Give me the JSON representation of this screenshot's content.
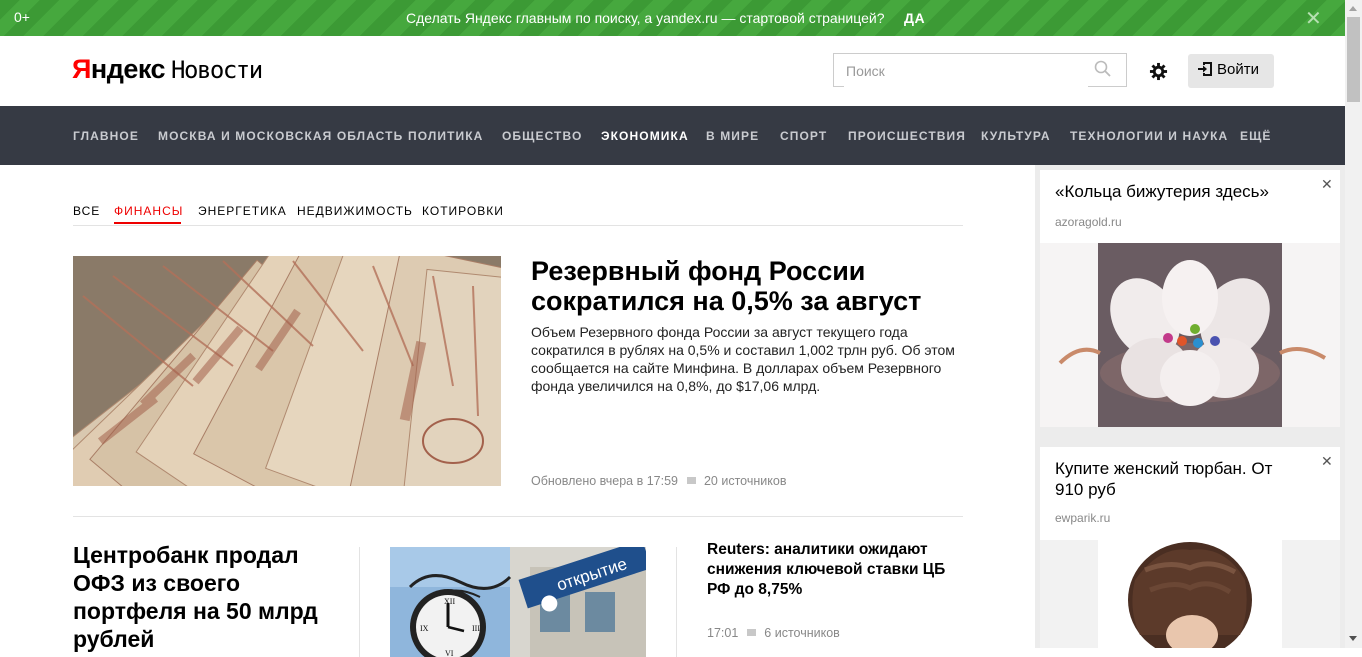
{
  "promo": {
    "age_rating": "0+",
    "message": "Сделать Яндекс главным по поиску, а yandex.ru — стартовой страницей?",
    "accept_label": "ДА",
    "close_glyph": "✕"
  },
  "header": {
    "logo_y": "Я",
    "logo_rest": "ндекс",
    "logo_service": "Новости",
    "search_placeholder": "Поиск",
    "login_label": "Войти"
  },
  "nav": {
    "items": [
      "ГЛАВНОЕ",
      "МОСКВА И МОСКОВСКАЯ ОБЛАСТЬ",
      "ПОЛИТИКА",
      "ОБЩЕСТВО",
      "ЭКОНОМИКА",
      "В МИРЕ",
      "СПОРТ",
      "ПРОИСШЕСТВИЯ",
      "КУЛЬТУРА",
      "ТЕХНОЛОГИИ И НАУКА",
      "ЕЩЁ"
    ],
    "active": "ЭКОНОМИКА"
  },
  "subnav": {
    "items": [
      "ВСЕ",
      "ФИНАНСЫ",
      "ЭНЕРГЕТИКА",
      "НЕДВИЖИМОСТЬ",
      "КОТИРОВКИ"
    ],
    "active": "ФИНАНСЫ"
  },
  "main_story": {
    "headline": "Резервный фонд России сократился на 0,5% за август",
    "lead": "Объем Резервного фонда России за август текущего года сократился в рублях на 0,5% и составил 1,002 трлн руб. Об этом сообщается на сайте Минфина. В долларах объем Резервного фонда увеличился на 0,8%, до $17,06 млрд.",
    "updated": "Обновлено вчера в 17:59",
    "sources": "20 источников"
  },
  "story2": {
    "headline": "Центробанк продал ОФЗ из своего портфеля на 50 млрд рублей"
  },
  "story3": {
    "headline": "Reuters: аналитики ожидают снижения ключевой ставки ЦБ РФ до 8,75%",
    "time": "17:01",
    "sources": "6 источников"
  },
  "image_signs": {
    "bank_sign": "открытие"
  },
  "ads": [
    {
      "title": "«Кольца бижутерия здесь»",
      "domain": "azoragold.ru",
      "close": "✕"
    },
    {
      "title": "Купите женский тюрбан. От 910 руб",
      "domain": "ewparik.ru",
      "close": "✕"
    }
  ],
  "colors": {
    "promo_green": "#46a83e",
    "nav_bg": "#363a44",
    "accent_red": "#ee0000",
    "logo_red": "#ff0000"
  }
}
